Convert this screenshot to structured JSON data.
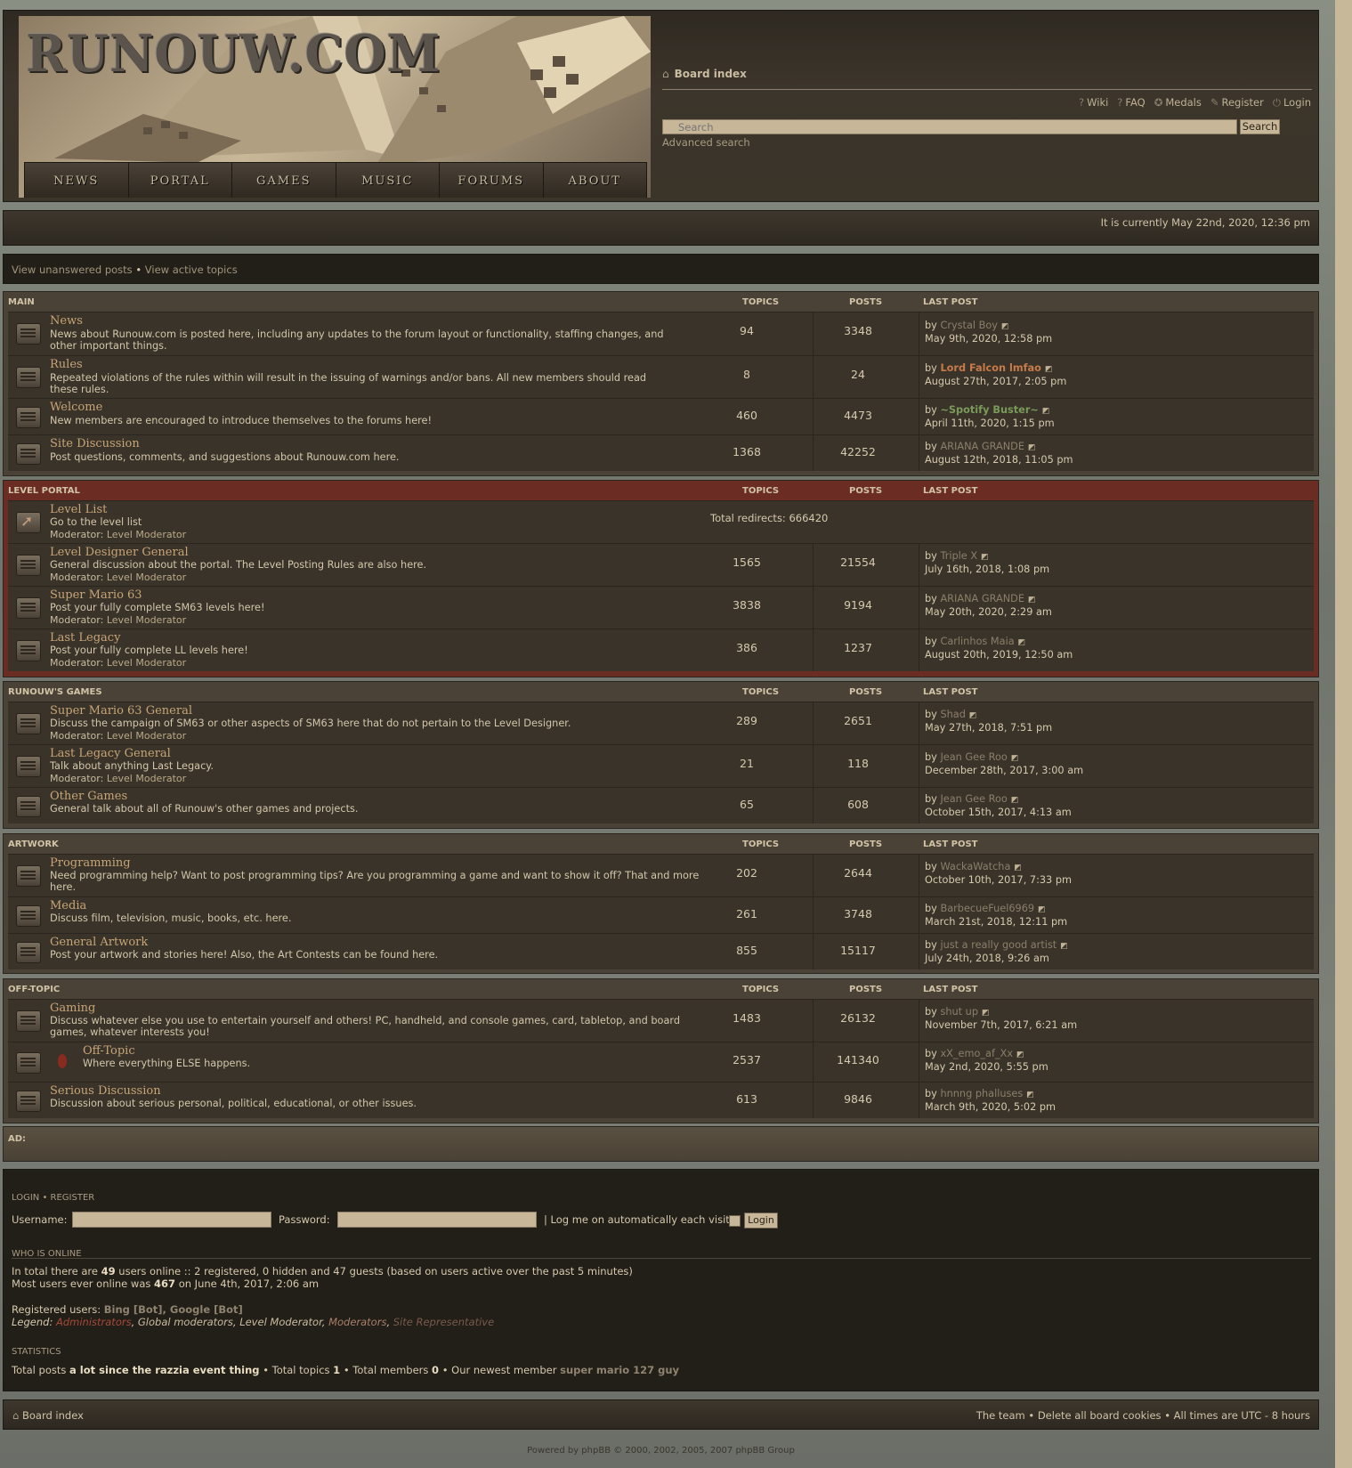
{
  "header": {
    "logo": "RUNOUW.COM",
    "nav": [
      "NEWS",
      "PORTAL",
      "GAMES",
      "MUSIC",
      "FORUMS",
      "ABOUT"
    ],
    "board_index": "Board index",
    "top_links": [
      "Wiki",
      "FAQ",
      "Medals",
      "Register",
      "Login"
    ],
    "search_placeholder": "Search",
    "search_button": "Search",
    "advanced_search": "Advanced search"
  },
  "current_time": "It is currently May 22nd, 2020, 12:36 pm",
  "view_links": {
    "unanswered": "View unanswered posts",
    "separator": "•",
    "active": "View active topics"
  },
  "columns": {
    "topics": "TOPICS",
    "posts": "POSTS",
    "last_post": "LAST POST"
  },
  "sections": [
    {
      "name": "MAIN",
      "forums": [
        {
          "title": "News",
          "desc": "News about Runouw.com is posted here, including any updates to the forum layout or functionality, staffing changes, and other important things.",
          "topics": "94",
          "posts": "3348",
          "last_by": "Crystal Boy",
          "last_date": "May 9th, 2020, 12:58 pm"
        },
        {
          "title": "Rules",
          "desc": "Repeated violations of the rules within will result in the issuing of warnings and/or bans. All new members should read these rules.",
          "topics": "8",
          "posts": "24",
          "last_by": "Lord Falcon lmfao",
          "last_date": "August 27th, 2017, 2:05 pm"
        },
        {
          "title": "Welcome",
          "desc": "New members are encouraged to introduce themselves to the forums here!",
          "topics": "460",
          "posts": "4473",
          "last_by": "~Spotify Buster~",
          "last_date": "April 11th, 2020, 1:15 pm"
        },
        {
          "title": "Site Discussion",
          "desc": "Post questions, comments, and suggestions about Runouw.com here.",
          "topics": "1368",
          "posts": "42252",
          "last_by": "ARIANA GRANDE",
          "last_date": "August 12th, 2018, 11:05 pm"
        }
      ]
    },
    {
      "name": "LEVEL PORTAL",
      "forums": [
        {
          "title": "Level List",
          "desc": "Go to the level list",
          "moderator_label": "Moderator:",
          "moderator": "Level Moderator",
          "redirects": "Total redirects: 666420"
        },
        {
          "title": "Level Designer General",
          "desc": "General discussion about the portal. The Level Posting Rules are also here.",
          "moderator_label": "Moderator:",
          "moderator": "Level Moderator",
          "topics": "1565",
          "posts": "21554",
          "last_by": "Triple X",
          "last_date": "July 16th, 2018, 1:08 pm"
        },
        {
          "title": "Super Mario 63",
          "desc": "Post your fully complete SM63 levels here!",
          "moderator_label": "Moderator:",
          "moderator": "Level Moderator",
          "topics": "3838",
          "posts": "9194",
          "last_by": "ARIANA GRANDE",
          "last_date": "May 20th, 2020, 2:29 am"
        },
        {
          "title": "Last Legacy",
          "desc": "Post your fully complete LL levels here!",
          "moderator_label": "Moderator:",
          "moderator": "Level Moderator",
          "topics": "386",
          "posts": "1237",
          "last_by": "Carlinhos Maia",
          "last_date": "August 20th, 2019, 12:50 am"
        }
      ]
    },
    {
      "name": "RUNOUW'S GAMES",
      "forums": [
        {
          "title": "Super Mario 63 General",
          "desc": "Discuss the campaign of SM63 or other aspects of SM63 here that do not pertain to the Level Designer.",
          "moderator_label": "Moderator:",
          "moderator": "Level Moderator",
          "topics": "289",
          "posts": "2651",
          "last_by": "Shad",
          "last_date": "May 27th, 2018, 7:51 pm"
        },
        {
          "title": "Last Legacy General",
          "desc": "Talk about anything Last Legacy.",
          "moderator_label": "Moderator:",
          "moderator": "Level Moderator",
          "topics": "21",
          "posts": "118",
          "last_by": "Jean Gee Roo",
          "last_date": "December 28th, 2017, 3:00 am"
        },
        {
          "title": "Other Games",
          "desc": "General talk about all of Runouw's other games and projects.",
          "topics": "65",
          "posts": "608",
          "last_by": "Jean Gee Roo",
          "last_date": "October 15th, 2017, 4:13 am"
        }
      ]
    },
    {
      "name": "ARTWORK",
      "forums": [
        {
          "title": "Programming",
          "desc": "Need programming help? Want to post programming tips? Are you programming a game and want to show it off? That and more here.",
          "topics": "202",
          "posts": "2644",
          "last_by": "WackaWatcha",
          "last_date": "October 10th, 2017, 7:33 pm"
        },
        {
          "title": "Media",
          "desc": "Discuss film, television, music, books, etc. here.",
          "topics": "261",
          "posts": "3748",
          "last_by": "BarbecueFuel6969",
          "last_date": "March 21st, 2018, 12:11 pm"
        },
        {
          "title": "General Artwork",
          "desc": "Post your artwork and stories here! Also, the Art Contests can be found here.",
          "topics": "855",
          "posts": "15117",
          "last_by": "just a really good artist",
          "last_date": "July 24th, 2018, 9:26 am"
        }
      ]
    },
    {
      "name": "OFF-TOPIC",
      "forums": [
        {
          "title": "Gaming",
          "desc": "Discuss whatever else you use to entertain yourself and others! PC, handheld, and console games, card, tabletop, and board games, whatever interests you!",
          "topics": "1483",
          "posts": "26132",
          "last_by": "shut up",
          "last_date": "November 7th, 2017, 6:21 am"
        },
        {
          "title": "Off-Topic",
          "desc": "Where everything ELSE happens.",
          "topics": "2537",
          "posts": "141340",
          "last_by": "xX_emo_af_Xx",
          "last_date": "May 2nd, 2020, 5:55 pm"
        },
        {
          "title": "Serious Discussion",
          "desc": "Discussion about serious personal, political, educational, or other issues.",
          "topics": "613",
          "posts": "9846",
          "last_by": "hnnng phalluses",
          "last_date": "March 9th, 2020, 5:02 pm"
        }
      ]
    }
  ],
  "by_label": "by",
  "ad_label": "AD:",
  "login": {
    "heading": "LOGIN • REGISTER",
    "username_label": "Username:",
    "password_label": "Password:",
    "auto_label": "| Log me on automatically each visit",
    "login_button": "Login"
  },
  "who_is_online": {
    "heading": "WHO IS ONLINE",
    "line1_pre": "In total there are ",
    "total": "49",
    "line1_post": " users online :: 2 registered, 0 hidden and 47 guests (based on users active over the past 5 minutes)",
    "line2_pre": "Most users ever online was ",
    "max": "467",
    "line2_post": " on June 4th, 2017, 2:06 am",
    "registered_label": "Registered users: ",
    "registered_users": "Bing [Bot], Google [Bot]",
    "legend_label": "Legend:",
    "legend": [
      "Administrators",
      "Global moderators",
      "Level Moderator",
      "Moderators",
      "Site Representative"
    ]
  },
  "statistics": {
    "heading": "STATISTICS",
    "total_posts_label": "Total posts ",
    "total_posts": "a lot since the razzia event thing",
    "total_topics_label": " • Total topics ",
    "total_topics": "1",
    "total_members_label": " • Total members ",
    "total_members": "0",
    "newest_label": " • Our newest member ",
    "newest": "super mario 127 guy"
  },
  "footer": {
    "board_index": "Board index",
    "right": "The team • Delete all board cookies • All times are UTC - 8 hours",
    "powered_by": "Powered by phpBB © 2000, 2002, 2005, 2007 phpBB Group"
  }
}
